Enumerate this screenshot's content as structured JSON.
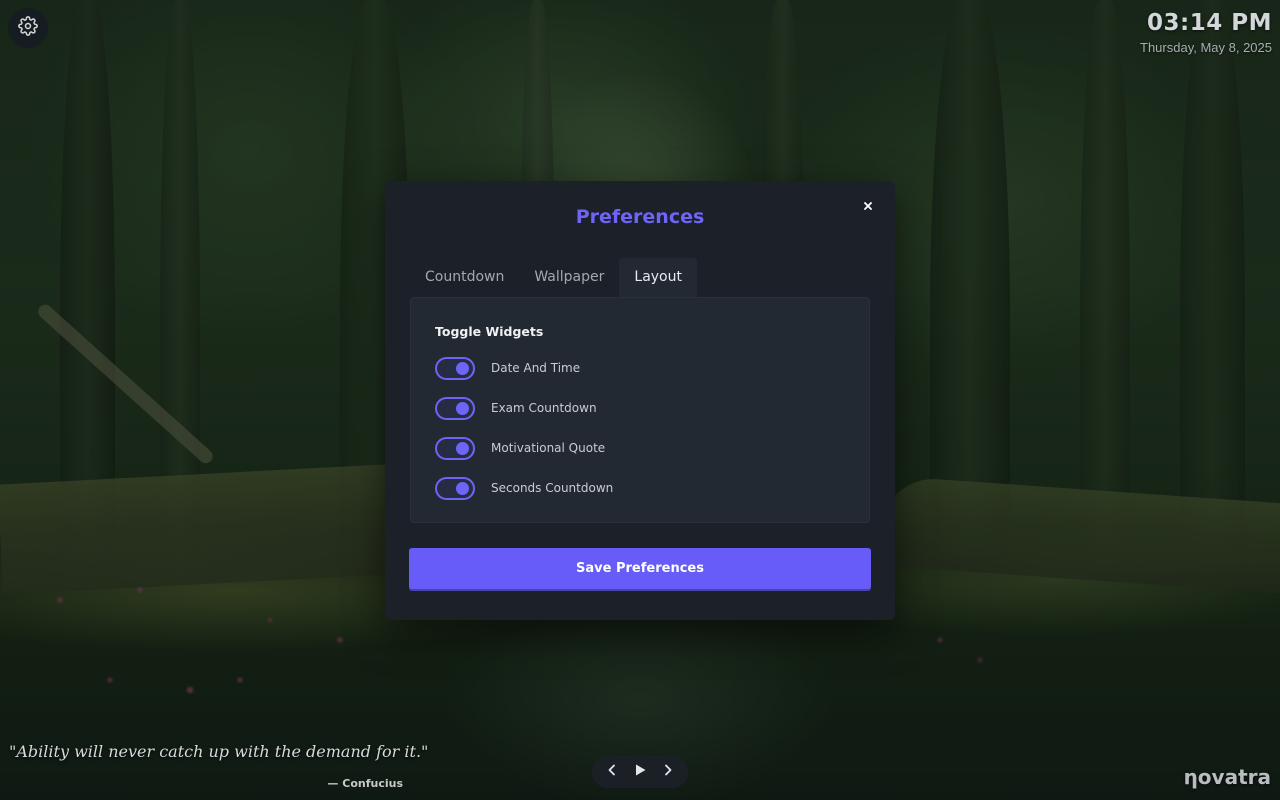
{
  "clock": {
    "time": "03:14 PM",
    "date": "Thursday, May 8, 2025"
  },
  "modal": {
    "title": "Preferences",
    "close_glyph": "×",
    "tabs": [
      {
        "label": "Countdown",
        "active": false
      },
      {
        "label": "Wallpaper",
        "active": false
      },
      {
        "label": "Layout",
        "active": true
      }
    ],
    "panel_heading": "Toggle Widgets",
    "toggles": [
      {
        "label": "Date And Time",
        "on": true
      },
      {
        "label": "Exam Countdown",
        "on": true
      },
      {
        "label": "Motivational Quote",
        "on": true
      },
      {
        "label": "Seconds Countdown",
        "on": true
      }
    ],
    "save_label": "Save Preferences"
  },
  "quote": {
    "text": "\"Ability will never catch up with the demand for it.\"",
    "author": "— Confucius"
  },
  "brand": "ηovatra",
  "icons": {
    "settings": "gear-icon",
    "close": "close-icon",
    "prev": "chevron-left-icon",
    "play": "play-icon",
    "next": "chevron-right-icon"
  },
  "colors": {
    "accent": "#6e65f7",
    "button": "#675cf7",
    "modal_bg": "#1c2129",
    "panel_bg": "#232933"
  }
}
